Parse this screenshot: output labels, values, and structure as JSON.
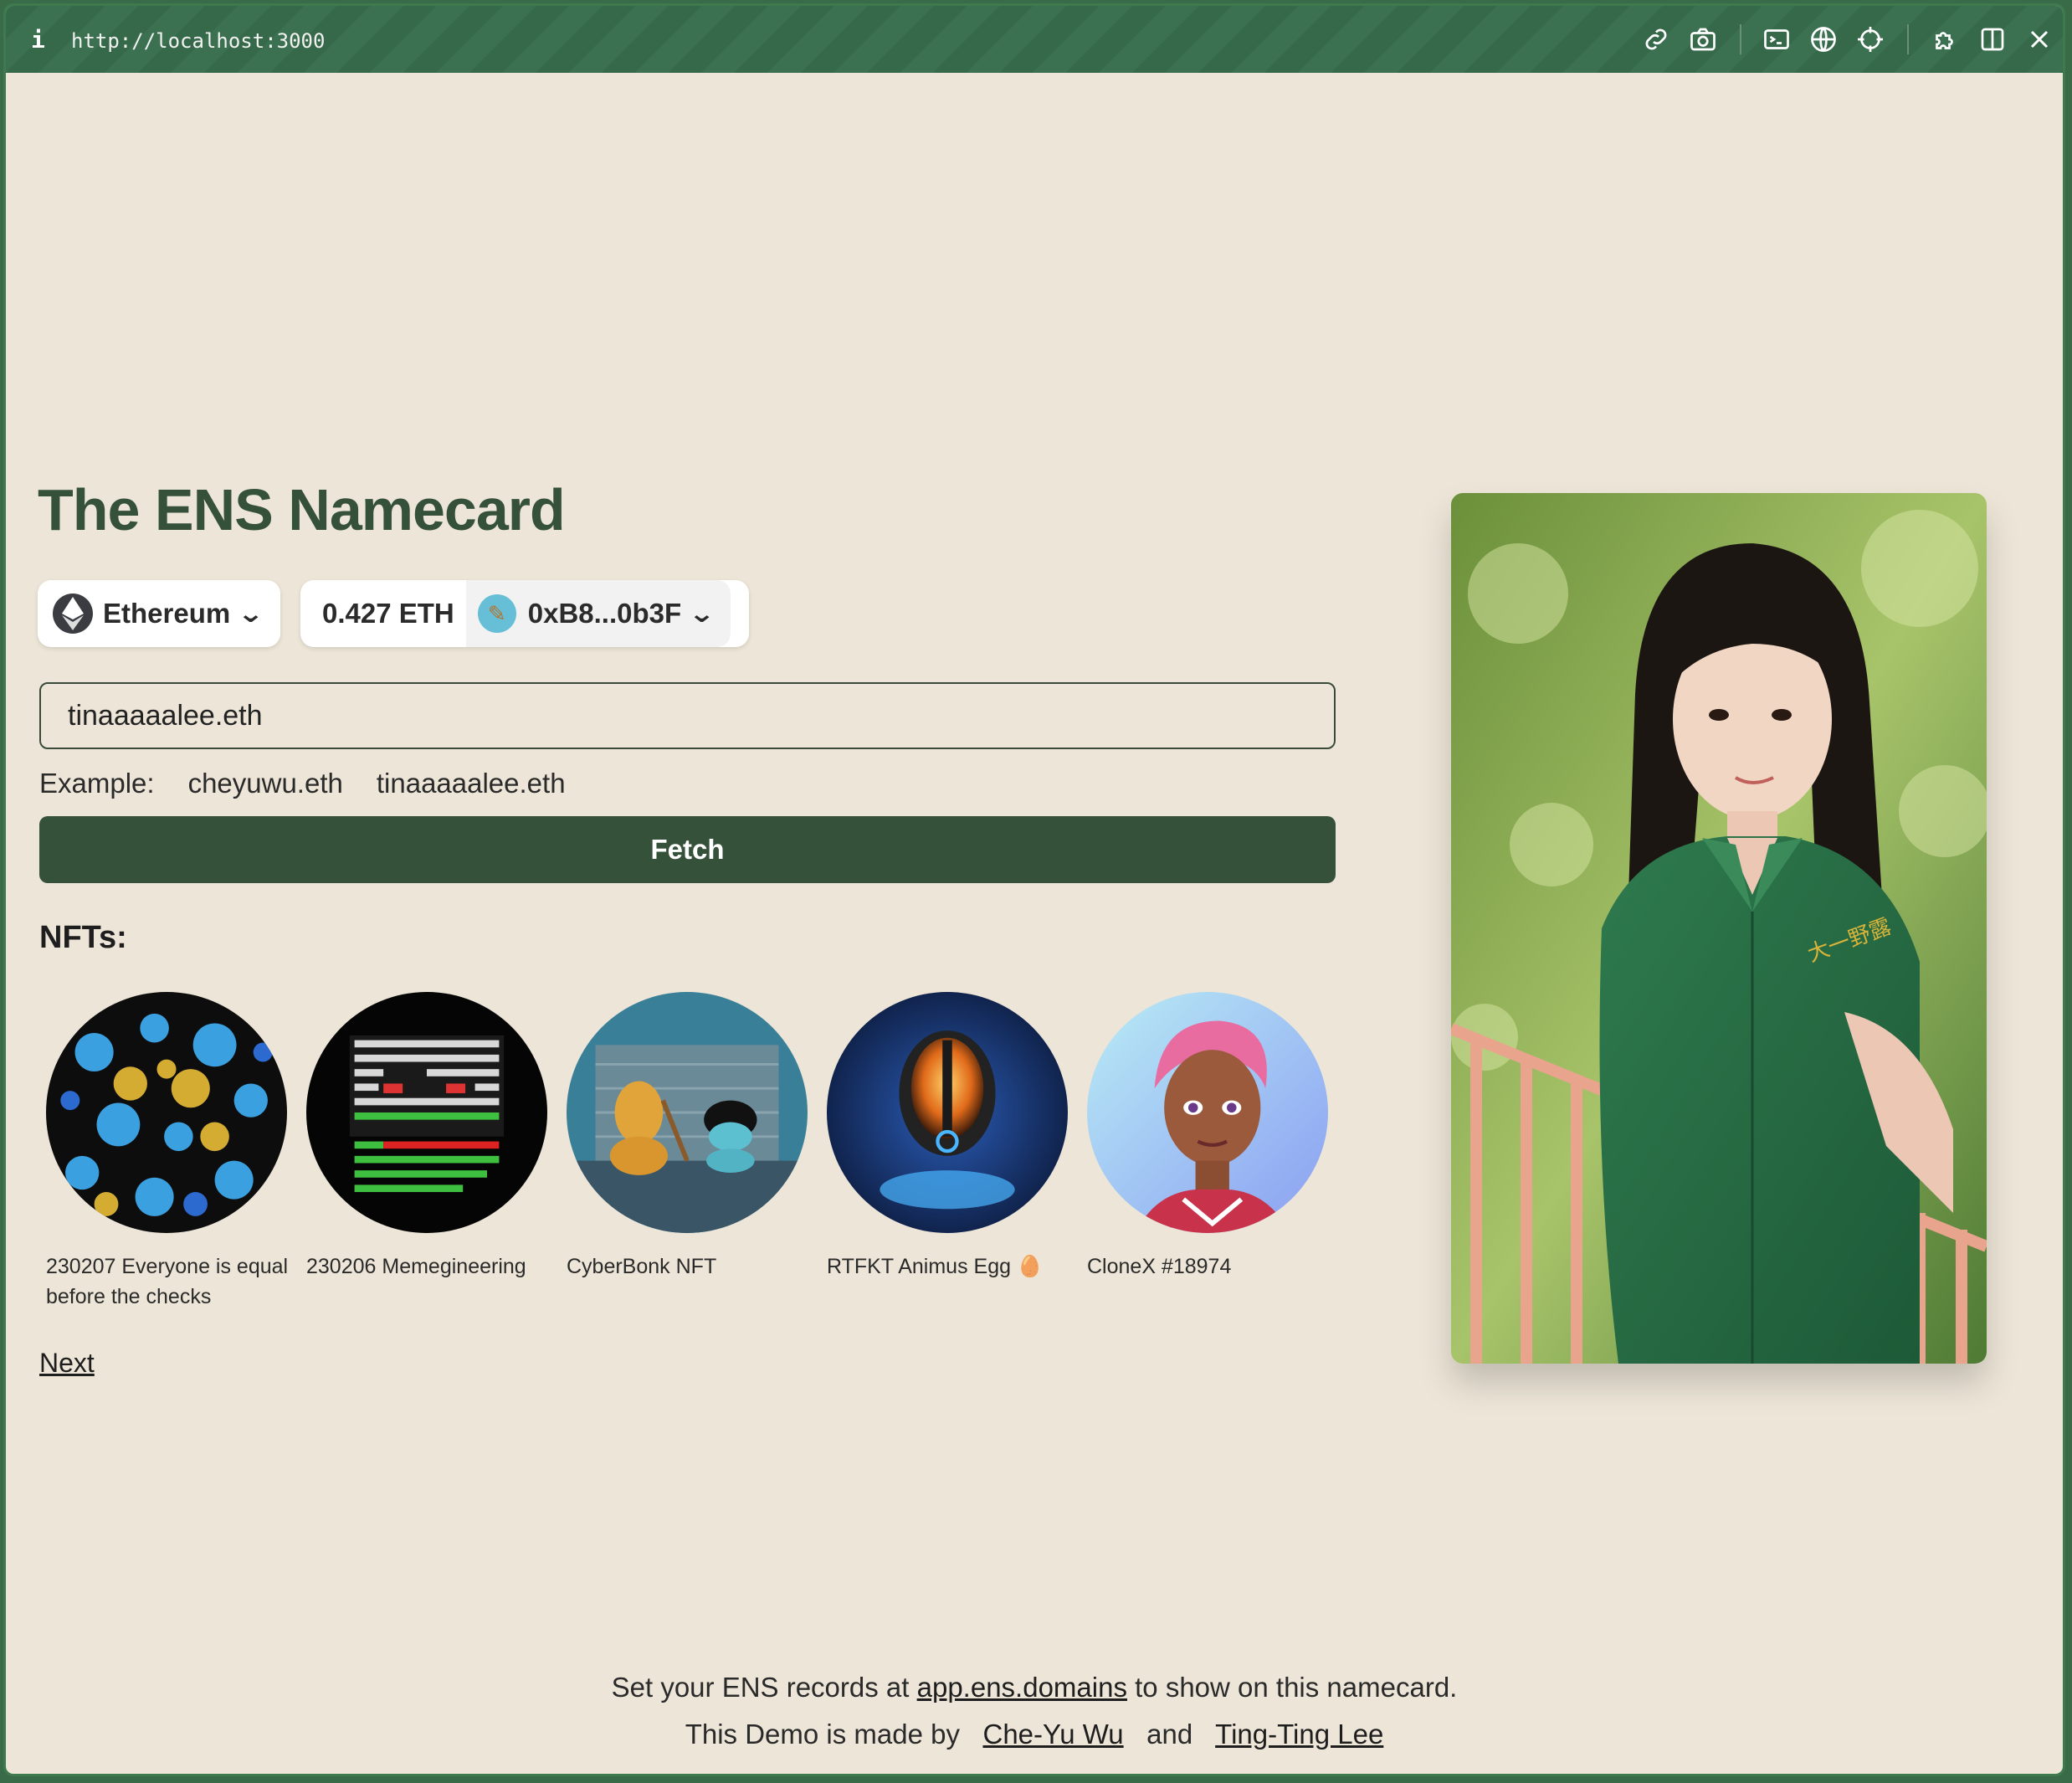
{
  "browser": {
    "url": "http://localhost:3000",
    "info_icon": "i",
    "icons": [
      "link-icon",
      "camera-icon",
      "terminal-icon",
      "globe-icon",
      "crosshair-icon",
      "extension-icon",
      "split-view-icon",
      "close-icon"
    ]
  },
  "app": {
    "title": "The ENS Namecard",
    "network": {
      "label": "Ethereum",
      "icon": "ethereum-icon"
    },
    "wallet": {
      "balance": "0.427 ETH",
      "address": "0xB8...0b3F"
    },
    "search": {
      "value": "tinaaaaalee.eth"
    },
    "examples": {
      "label": "Example:",
      "items": [
        "cheyuwu.eth",
        "tinaaaaalee.eth"
      ]
    },
    "fetch_label": "Fetch",
    "nfts_label": "NFTs:",
    "nfts": [
      {
        "name": "230207 Everyone is equal before the checks"
      },
      {
        "name": "230206 Memegineering"
      },
      {
        "name": "CyberBonk NFT"
      },
      {
        "name": "RTFKT Animus Egg 🥚"
      },
      {
        "name": "CloneX #18974"
      }
    ],
    "next_label": "Next"
  },
  "footer": {
    "line1_prefix": "Set your ENS records at",
    "line1_link": "app.ens.domains",
    "line1_suffix": "to show on this namecard.",
    "line2_prefix": "This Demo is made by",
    "author1": "Che-Yu Wu",
    "and": "and",
    "author2": "Ting-Ting Lee"
  },
  "colors": {
    "background": "#ede6d8",
    "accent": "#36513a",
    "titlebar": "#3a6b48"
  }
}
